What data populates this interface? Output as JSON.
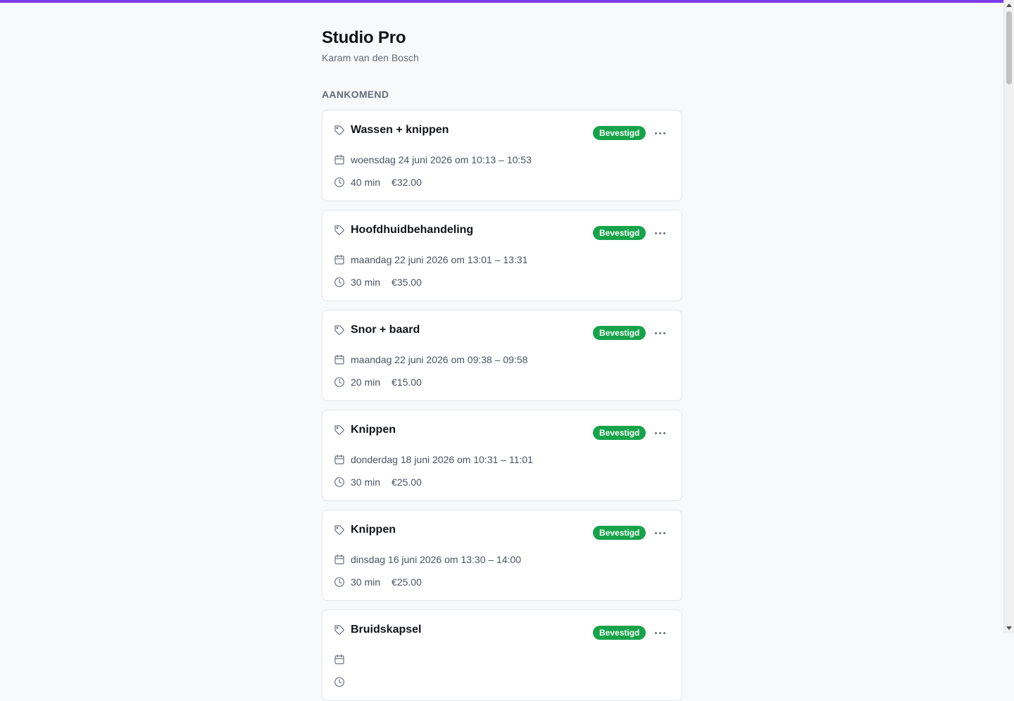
{
  "app": {
    "title": "Studio Pro",
    "subtitle": "Karam van den Bosch",
    "accent_color": "#7c3aed"
  },
  "section": {
    "label": "AANKOMEND"
  },
  "status_color": "#16a34a",
  "appointments": [
    {
      "service": "Wassen + knippen",
      "status": "Bevestigd",
      "datetime": "woensdag 24 juni 2026 om 10:13 – 10:53",
      "duration": "40 min",
      "price": "€32.00"
    },
    {
      "service": "Hoofdhuidbehandeling",
      "status": "Bevestigd",
      "datetime": "maandag 22 juni 2026 om 13:01 – 13:31",
      "duration": "30 min",
      "price": "€35.00"
    },
    {
      "service": "Snor + baard",
      "status": "Bevestigd",
      "datetime": "maandag 22 juni 2026 om 09:38 – 09:58",
      "duration": "20 min",
      "price": "€15.00"
    },
    {
      "service": "Knippen",
      "status": "Bevestigd",
      "datetime": "donderdag 18 juni 2026 om 10:31 – 11:01",
      "duration": "30 min",
      "price": "€25.00"
    },
    {
      "service": "Knippen",
      "status": "Bevestigd",
      "datetime": "dinsdag 16 juni 2026 om 13:30 – 14:00",
      "duration": "30 min",
      "price": "€25.00"
    },
    {
      "service": "Bruidskapsel",
      "status": "Bevestigd",
      "datetime": "",
      "duration": "",
      "price": ""
    }
  ]
}
